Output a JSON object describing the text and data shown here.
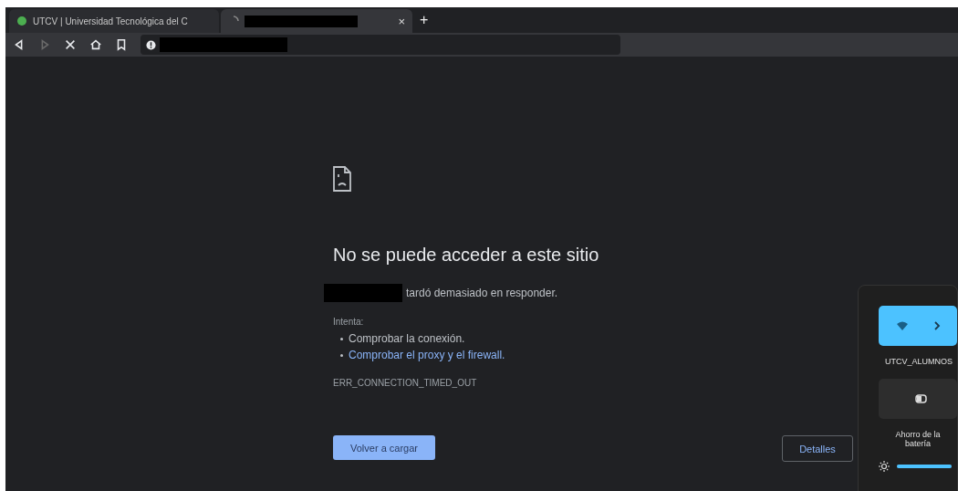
{
  "tabs": [
    {
      "title": "UTCV | Universidad Tecnológica del C",
      "selected": false,
      "loading": false,
      "redacted": false
    },
    {
      "selected": true,
      "loading": true,
      "redacted": true
    }
  ],
  "tab_close": "×",
  "new_tab": "+",
  "toolbar": {
    "forward_disabled": true
  },
  "error_page": {
    "heading": "No se puede acceder a este sitio",
    "message": "tardó demasiado en responder.",
    "suggest_label": "Intenta:",
    "suggestions": [
      {
        "text": "Comprobar la conexión.",
        "kind": "text"
      },
      {
        "text": "Comprobar el proxy y el firewall.",
        "kind": "link"
      }
    ],
    "code": "ERR_CONNECTION_TIMED_OUT",
    "reload_button": "Volver a cargar",
    "details_button": "Detalles"
  },
  "quick_settings": {
    "tiles": [
      {
        "label": "UTCV_ALUMNOS",
        "kind": "wifi",
        "on": true
      },
      {
        "label": "Ahorro de la batería",
        "kind": "battery",
        "on": false
      }
    ],
    "brightness": {
      "level": 1
    }
  }
}
